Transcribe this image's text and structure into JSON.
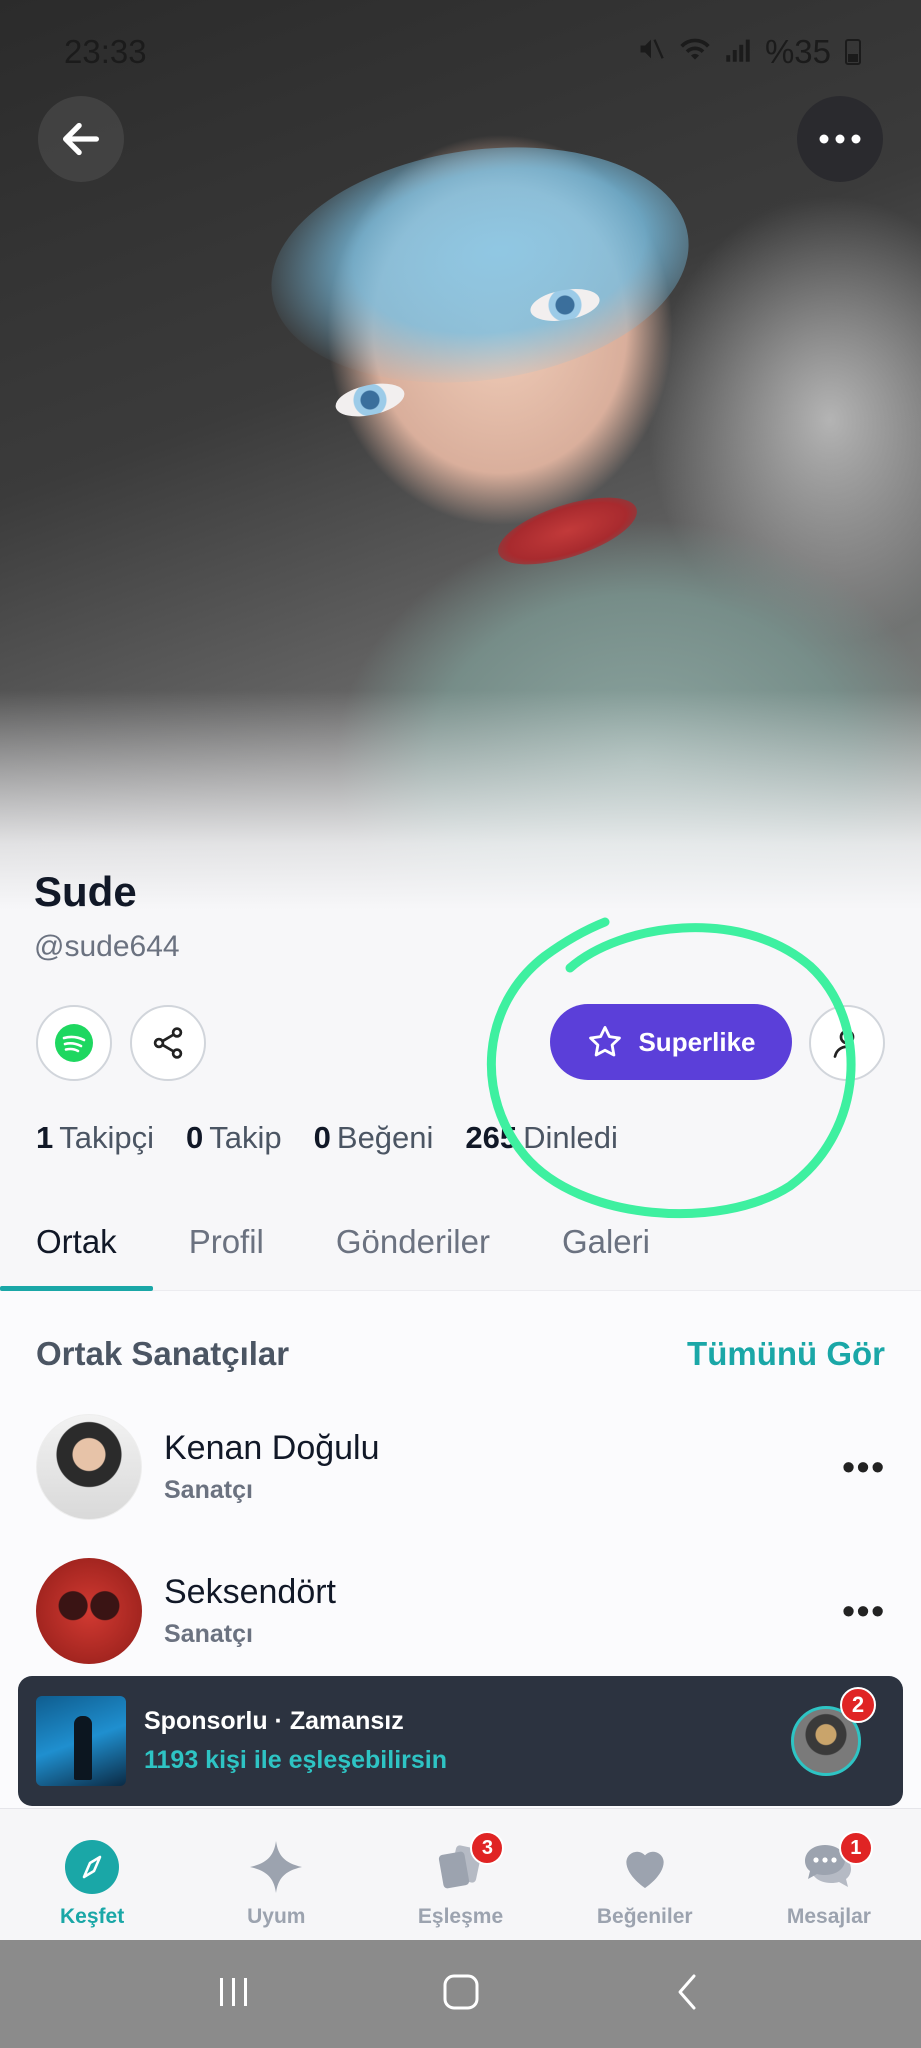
{
  "status_bar": {
    "time": "23:33",
    "battery": "%35"
  },
  "profile": {
    "name": "Sude",
    "handle": "@sude644"
  },
  "actions": {
    "superlike_label": "Superlike"
  },
  "stats": {
    "followers_count": "1",
    "followers_label": "Takipçi",
    "following_count": "0",
    "following_label": "Takip",
    "likes_count": "0",
    "likes_label": "Beğeni",
    "listened_count": "265",
    "listened_label": "Dinledi"
  },
  "tabs": [
    {
      "label": "Ortak",
      "active": true
    },
    {
      "label": "Profil",
      "active": false
    },
    {
      "label": "Gönderiler",
      "active": false
    },
    {
      "label": "Galeri",
      "active": false
    }
  ],
  "common_artists": {
    "title": "Ortak Sanatçılar",
    "see_all": "Tümünü Gör",
    "items": [
      {
        "name": "Kenan Doğulu",
        "type": "Sanatçı"
      },
      {
        "name": "Seksendört",
        "type": "Sanatçı"
      }
    ]
  },
  "sponsor": {
    "title": "Sponsorlu · Zamansız",
    "subtitle": "1193 kişi ile eşleşebilirsin",
    "badge": "2"
  },
  "bottom_nav": [
    {
      "label": "Keşfet",
      "icon": "compass-icon",
      "active": true,
      "badge": ""
    },
    {
      "label": "Uyum",
      "icon": "sparkle-icon",
      "active": false,
      "badge": ""
    },
    {
      "label": "Eşleşme",
      "icon": "cards-icon",
      "active": false,
      "badge": "3"
    },
    {
      "label": "Beğeniler",
      "icon": "heart-icon",
      "active": false,
      "badge": ""
    },
    {
      "label": "Mesajlar",
      "icon": "chat-icon",
      "active": false,
      "badge": "1"
    }
  ],
  "colors": {
    "accent": "#1aa7a7",
    "superlike": "#5b3fd9",
    "annotation": "#3ef0a0",
    "badge": "#e02424"
  }
}
